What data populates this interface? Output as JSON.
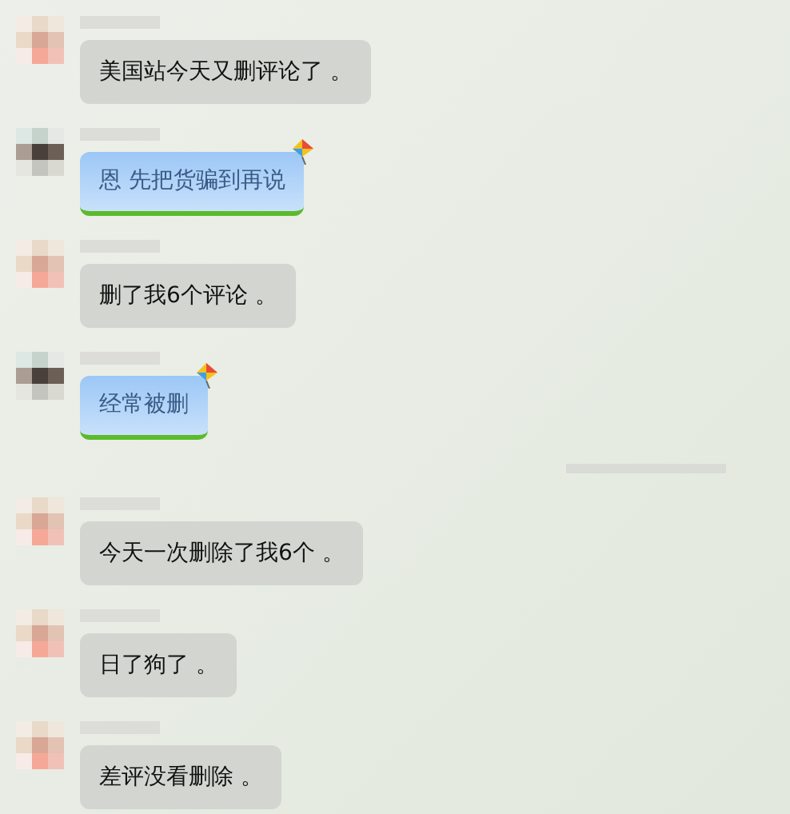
{
  "messages": [
    {
      "kind": "plain",
      "text": "美国站今天又删评论了 。"
    },
    {
      "kind": "kite",
      "text": "恩 先把货骗到再说"
    },
    {
      "kind": "plain",
      "text": "删了我6个评论 。"
    },
    {
      "kind": "kite",
      "text": "经常被删"
    },
    {
      "kind": "divider"
    },
    {
      "kind": "plain",
      "text": "今天一次删除了我6个 。"
    },
    {
      "kind": "plain",
      "text": "日了狗了 。"
    },
    {
      "kind": "plain",
      "text": "差评没看删除 。"
    }
  ]
}
